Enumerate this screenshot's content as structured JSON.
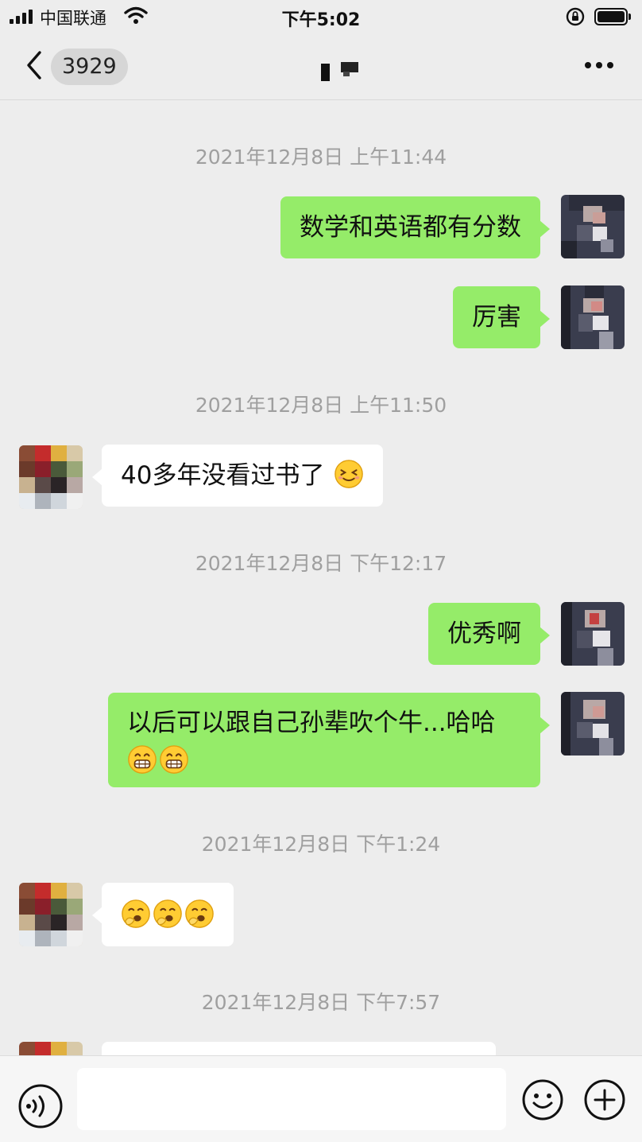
{
  "status_bar": {
    "carrier": "中国联通",
    "time": "下午5:02"
  },
  "nav": {
    "unread_count": "3929"
  },
  "messages": [
    {
      "type": "timestamp",
      "text": "2021年12月8日 上午11:44"
    },
    {
      "type": "message",
      "side": "me",
      "text": "数学和英语都有分数"
    },
    {
      "type": "message",
      "side": "me",
      "text": "厉害"
    },
    {
      "type": "timestamp",
      "text": "2021年12月8日 上午11:50"
    },
    {
      "type": "message",
      "side": "other",
      "text": "40多年没看过书了",
      "emoji": [
        "grinning-squint-face-icon"
      ]
    },
    {
      "type": "timestamp",
      "text": "2021年12月8日 下午12:17"
    },
    {
      "type": "message",
      "side": "me",
      "text": "优秀啊"
    },
    {
      "type": "message",
      "side": "me",
      "text": "以后可以跟自己孙辈吹个牛...哈哈",
      "emoji": [
        "grin-face-icon",
        "grin-face-icon"
      ]
    },
    {
      "type": "timestamp",
      "text": "2021年12月8日 下午1:24"
    },
    {
      "type": "message",
      "side": "other",
      "text": "",
      "emoji": [
        "yawn-face-icon",
        "yawn-face-icon",
        "yawn-face-icon"
      ]
    },
    {
      "type": "timestamp",
      "text": "2021年12月8日 下午7:57"
    }
  ],
  "colors": {
    "my_bubble": "#95ec69",
    "other_bubble": "#ffffff",
    "background": "#ededed",
    "timestamp": "#9f9f9f"
  },
  "input": {
    "value": "",
    "placeholder": ""
  }
}
